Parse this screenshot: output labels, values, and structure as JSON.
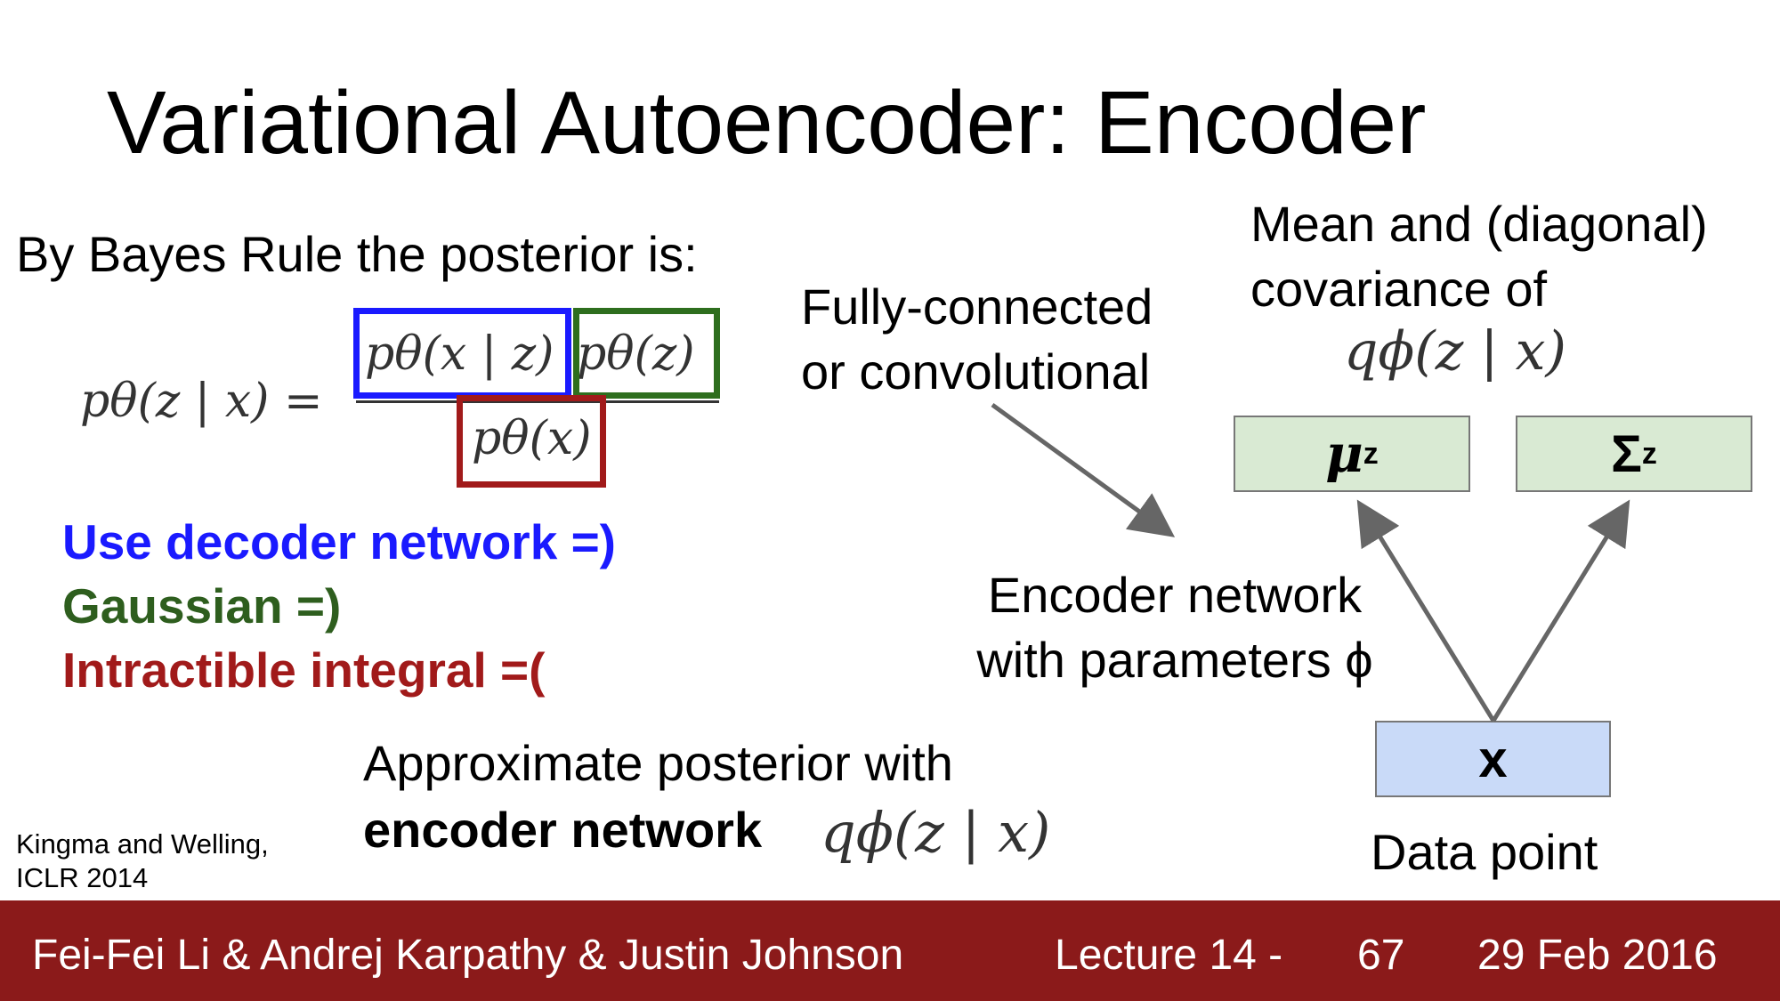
{
  "slide": {
    "title": "Variational Autoencoder: Encoder",
    "bayes_text": "By Bayes Rule the posterior is:",
    "equation": {
      "lhs": "pθ(z | x) =",
      "numerator_blue": "pθ(x | z)",
      "numerator_green": "pθ(z)",
      "denominator_red": "pθ(x)"
    },
    "notes": [
      {
        "text": "Use decoder network =)",
        "color": "#1a1aff"
      },
      {
        "text": "Gaussian =)",
        "color": "#2e5e1e"
      },
      {
        "text": "Intractible integral =(",
        "color": "#a11a1a"
      }
    ],
    "fc_lines": [
      "Fully-connected",
      "or convolutional"
    ],
    "mean_lines": [
      "Mean and (diagonal)",
      "covariance of"
    ],
    "mean_formula": "qϕ(z | x)",
    "mu_label": "μ",
    "mu_sup": "z",
    "sigma_label": "Σ",
    "sigma_sup": "z",
    "encoder_lines": [
      "Encoder network",
      "with parameters ϕ"
    ],
    "x_label": "x",
    "data_point": "Data point",
    "approx_line1": "Approximate posterior with",
    "approx_line2": "encoder network",
    "approx_formula": "qϕ(z | x)",
    "citation_lines": [
      "Kingma and Welling,",
      "ICLR 2014"
    ],
    "colors": {
      "blue": "#1a1aff",
      "green": "#2e6e1e",
      "red": "#a11a1a",
      "node_green": "#d9ead3",
      "node_blue": "#c9daf8",
      "footer_bg": "#8b1a1a",
      "arrow": "#666666"
    }
  },
  "footer": {
    "authors": "Fei-Fei Li & Andrej Karpathy & Justin Johnson",
    "lecture": "Lecture 14 -",
    "page": "67",
    "date": "29 Feb 2016"
  }
}
